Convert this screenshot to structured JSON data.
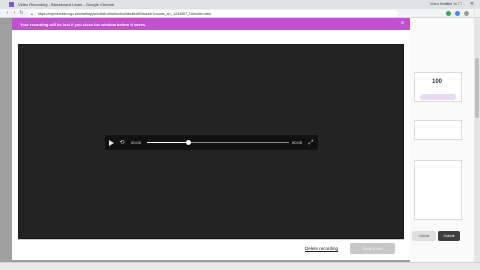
{
  "browser": {
    "window_title": "Video Recording - Blackboard Learn - Google Chrome",
    "url": "https://myriverside.rcgc.edu/webapps/collab-ultra/tool/collabultra/lti/launch?course_id=_1234567_1&mode=view",
    "bg_tabs": [
      "Video Note",
      "Add Yo"
    ],
    "window_controls": {
      "minimize": "–",
      "maximize": "□",
      "close": "✕"
    },
    "colors": {
      "accent": "#c350d1",
      "favicon": "#7e57c2"
    }
  },
  "background": {
    "score": "100",
    "buttons": {
      "cancel": "Cancel",
      "submit": "Submit"
    }
  },
  "modal": {
    "banner": {
      "text": "Your recording will be lost if you close the window before it saves.",
      "close_icon": "close-icon"
    },
    "player": {
      "current_time": "00:00",
      "duration": "00:05",
      "progress_fraction": 0.29,
      "icons": [
        "play-icon",
        "rewind-icon",
        "fullscreen-icon"
      ]
    },
    "footer": {
      "delete_label": "Delete recording",
      "save_label": "Save & exit"
    }
  }
}
